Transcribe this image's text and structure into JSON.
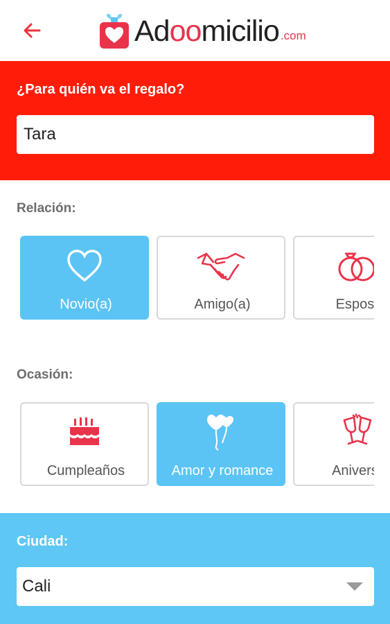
{
  "header": {
    "back_icon": "arrow-left-icon",
    "logo": {
      "prefix": "Ad",
      "oo": "oo",
      "suffix": "micilio",
      "com": ".com"
    }
  },
  "gift": {
    "title": "¿Para quién va el regalo?",
    "recipient_value": "Tara"
  },
  "relation": {
    "label": "Relación:",
    "items": [
      {
        "label": "Novio(a)",
        "icon": "heart-icon",
        "selected": true
      },
      {
        "label": "Amigo(a)",
        "icon": "handshake-icon",
        "selected": false
      },
      {
        "label": "Esposo",
        "icon": "rings-icon",
        "selected": false
      }
    ]
  },
  "occasion": {
    "label": "Ocasión:",
    "items": [
      {
        "label": "Cumpleaños",
        "icon": "cake-icon",
        "selected": false
      },
      {
        "label": "Amor y romance",
        "icon": "heart-balloons-icon",
        "selected": true
      },
      {
        "label": "Aniversa",
        "icon": "champagne-glasses-icon",
        "selected": false
      }
    ]
  },
  "city": {
    "label": "Ciudad:",
    "value": "Cali"
  },
  "colors": {
    "brand_red": "#ff1d0a",
    "accent_pink": "#e8334a",
    "selected_blue": "#5bc4f5"
  }
}
